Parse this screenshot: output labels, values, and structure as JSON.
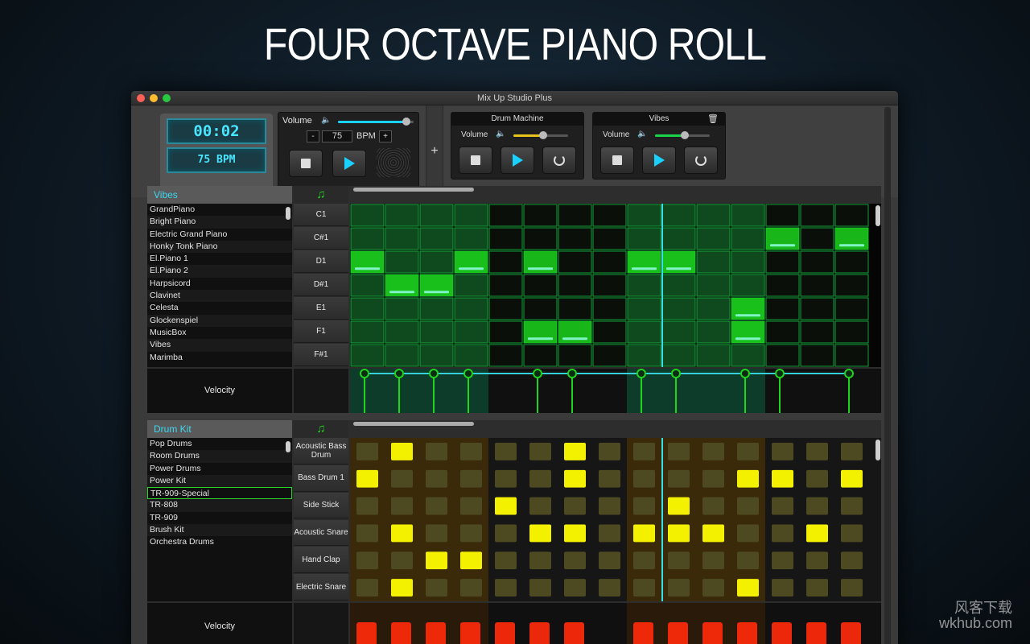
{
  "headline": "FOUR OCTAVE PIANO ROLL",
  "window": {
    "title": "Mix Up Studio Plus"
  },
  "clock": {
    "time": "00:02",
    "bpm_display": "75 BPM"
  },
  "master": {
    "volume_label": "Volume",
    "bpm_value": "75",
    "bpm_label": "BPM",
    "minus": "-",
    "plus": "+",
    "volume_level": 0.9
  },
  "add_track": "+",
  "tracks": [
    {
      "title": "Drum Machine",
      "volume_label": "Volume",
      "volume_level": 0.55,
      "fill_color": "#e6c21a"
    },
    {
      "title": "Vibes",
      "volume_label": "Volume",
      "volume_level": 0.55,
      "fill_color": "#19d44a"
    }
  ],
  "piano": {
    "instrument": "Vibes",
    "instruments": [
      "GrandPiano",
      "Bright Piano",
      "Electric Grand Piano",
      "Honky Tonk Piano",
      "El.Piano 1",
      "El.Piano 2",
      "Harpsicord",
      "Clavinet",
      "Celesta",
      "Glockenspiel",
      "MusicBox",
      "Vibes",
      "Marimba"
    ],
    "keys": [
      "C1",
      "C#1",
      "D1",
      "D#1",
      "E1",
      "F1",
      "F#1"
    ],
    "notes": [
      {
        "row": 2,
        "col": 0
      },
      {
        "row": 3,
        "col": 1
      },
      {
        "row": 3,
        "col": 2
      },
      {
        "row": 2,
        "col": 3
      },
      {
        "row": 5,
        "col": 5
      },
      {
        "row": 2,
        "col": 5
      },
      {
        "row": 5,
        "col": 6
      },
      {
        "row": 2,
        "col": 8
      },
      {
        "row": 2,
        "col": 9
      },
      {
        "row": 4,
        "col": 11
      },
      {
        "row": 5,
        "col": 11
      },
      {
        "row": 1,
        "col": 12
      },
      {
        "row": 1,
        "col": 14
      }
    ],
    "velocity_label": "Velocity",
    "velocity_steps": [
      0,
      1,
      2,
      3,
      5,
      6,
      8,
      9,
      11,
      12,
      14
    ],
    "note_color": "#1bd41b"
  },
  "drums": {
    "kit": "Drum Kit",
    "kits": [
      "Pop Drums",
      "Room Drums",
      "Power Drums",
      "Power Kit",
      "TR-909-Special",
      "TR-808",
      "TR-909",
      "Brush Kit",
      "Orchestra Drums"
    ],
    "selected_kit": "TR-909-Special",
    "sounds": [
      "Acoustic Bass Drum",
      "Bass Drum 1",
      "Side Stick",
      "Acoustic Snare",
      "Hand Clap",
      "Electric Snare"
    ],
    "hits": [
      {
        "row": 0,
        "col": 1
      },
      {
        "row": 0,
        "col": 6
      },
      {
        "row": 1,
        "col": 0
      },
      {
        "row": 1,
        "col": 6
      },
      {
        "row": 1,
        "col": 11
      },
      {
        "row": 1,
        "col": 12
      },
      {
        "row": 1,
        "col": 14
      },
      {
        "row": 2,
        "col": 4
      },
      {
        "row": 2,
        "col": 9
      },
      {
        "row": 3,
        "col": 1
      },
      {
        "row": 3,
        "col": 5
      },
      {
        "row": 3,
        "col": 6
      },
      {
        "row": 3,
        "col": 8
      },
      {
        "row": 3,
        "col": 9
      },
      {
        "row": 3,
        "col": 10
      },
      {
        "row": 3,
        "col": 13
      },
      {
        "row": 4,
        "col": 2
      },
      {
        "row": 4,
        "col": 3
      },
      {
        "row": 5,
        "col": 1
      },
      {
        "row": 5,
        "col": 11
      }
    ],
    "velocity_label": "Velocity",
    "hit_color": "#f3f000"
  },
  "watermark": {
    "line1": "风客下载",
    "line2": "wkhub.com"
  }
}
